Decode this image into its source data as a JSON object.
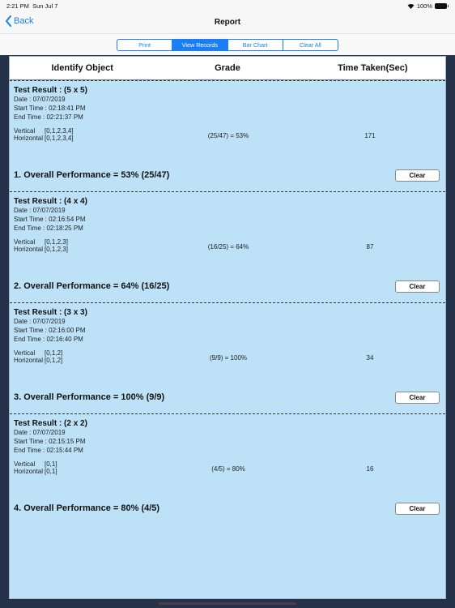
{
  "status_bar": {
    "time": "2:21 PM",
    "date": "Sun Jul 7",
    "battery": "100%"
  },
  "nav": {
    "back_label": "Back",
    "title": "Report"
  },
  "segments": [
    {
      "label": "Print",
      "active": false
    },
    {
      "label": "View Records",
      "active": true
    },
    {
      "label": "Bar Chart",
      "active": false
    },
    {
      "label": "Clear All",
      "active": false
    }
  ],
  "table": {
    "headers": [
      "Identify Object",
      "Grade",
      "Time Taken(Sec)"
    ]
  },
  "records": [
    {
      "title": "Test Result : (5 x 5)",
      "date": "Date : 07/07/2019",
      "start": "Start Time : 02:18:41 PM",
      "end": "End Time   : 02:21:37 PM",
      "vertical_label": "Vertical",
      "vertical": "[0,1,2,3,4]",
      "horizontal_label": "Horizontal",
      "horizontal": "[0,1,2,3,4]",
      "grade": "(25/47) = 53%",
      "time_taken": "171",
      "performance": "1. Overall Performance = 53% (25/47)",
      "clear_label": "Clear"
    },
    {
      "title": "Test Result : (4 x 4)",
      "date": "Date : 07/07/2019",
      "start": "Start Time : 02:16:54 PM",
      "end": "End Time   : 02:18:25 PM",
      "vertical_label": "Vertical",
      "vertical": "[0,1,2,3]",
      "horizontal_label": "Horizontal",
      "horizontal": "[0,1,2,3]",
      "grade": "(16/25) = 64%",
      "time_taken": "87",
      "performance": "2. Overall Performance = 64% (16/25)",
      "clear_label": "Clear"
    },
    {
      "title": "Test Result : (3 x 3)",
      "date": "Date : 07/07/2019",
      "start": "Start Time : 02:16:00 PM",
      "end": "End Time   : 02:16:40 PM",
      "vertical_label": "Vertical",
      "vertical": "[0,1,2]",
      "horizontal_label": "Horizontal",
      "horizontal": "[0,1,2]",
      "grade": "(9/9) = 100%",
      "time_taken": "34",
      "performance": "3. Overall Performance = 100% (9/9)",
      "clear_label": "Clear"
    },
    {
      "title": "Test Result : (2 x 2)",
      "date": "Date : 07/07/2019",
      "start": "Start Time : 02:15:15 PM",
      "end": "End Time   : 02:15:44 PM",
      "vertical_label": "Vertical",
      "vertical": "[0,1]",
      "horizontal_label": "Horizontal",
      "horizontal": "[0,1]",
      "grade": "(4/5) = 80%",
      "time_taken": "16",
      "performance": "4. Overall Performance = 80% (4/5)",
      "clear_label": "Clear"
    }
  ],
  "colors": {
    "accent": "#1a7ef5",
    "panel_bg": "#bde2f8",
    "outer_bg": "#26314a"
  }
}
